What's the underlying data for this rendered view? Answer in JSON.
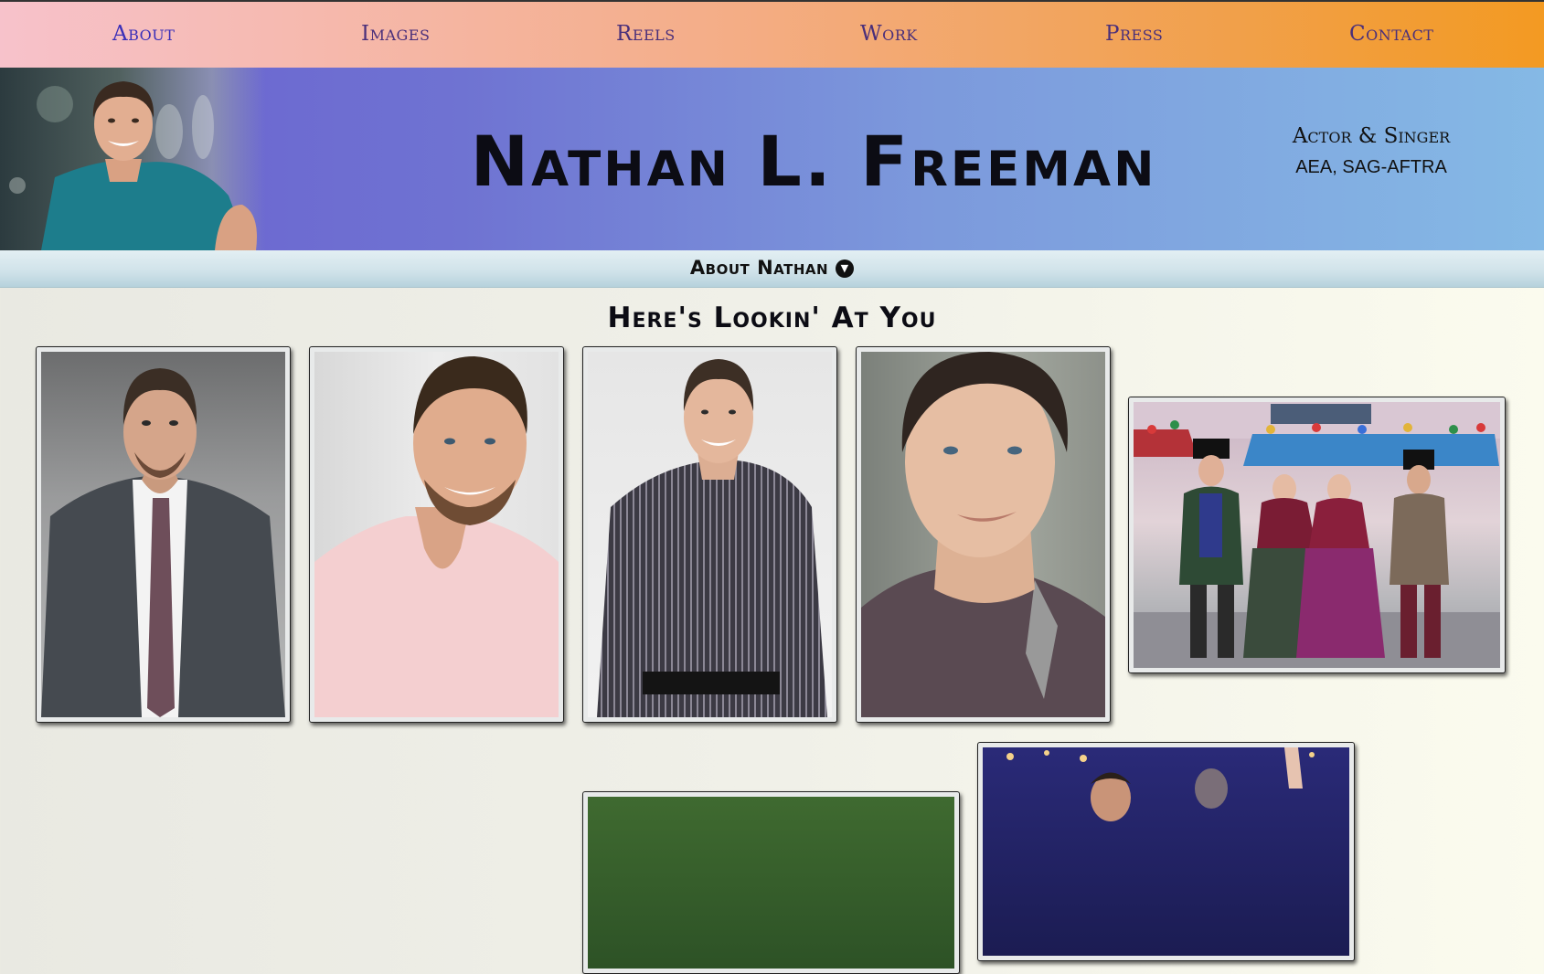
{
  "nav": {
    "items": [
      {
        "label": "About"
      },
      {
        "label": "Images"
      },
      {
        "label": "Reels"
      },
      {
        "label": "Work"
      },
      {
        "label": "Press"
      },
      {
        "label": "Contact"
      }
    ],
    "current": "About"
  },
  "header": {
    "title": "Nathan L. Freeman",
    "role": "Actor & Singer",
    "unions": "AEA, SAG-AFTRA"
  },
  "subnav": {
    "label": "About Nathan",
    "icon": "chevron-down-circle-icon"
  },
  "gallery": {
    "heading": "Here's Lookin' At You",
    "photos": [
      {
        "name": "headshot-suit-tie"
      },
      {
        "name": "headshot-pink-shirt"
      },
      {
        "name": "headshot-striped-shirt"
      },
      {
        "name": "headshot-close-up"
      },
      {
        "name": "main-street-carolers"
      },
      {
        "name": "garden-photo"
      },
      {
        "name": "stage-performance-photo"
      }
    ]
  },
  "colors": {
    "nav_gradient_start": "#f7c2cb",
    "nav_gradient_end": "#f39a22",
    "banner_gradient_start": "#6a5fcf",
    "banner_gradient_end": "#85b9e5",
    "nav_text": "#4a2f7a"
  }
}
